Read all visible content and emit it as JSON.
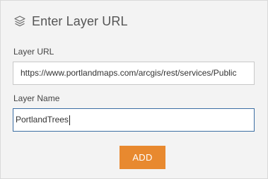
{
  "dialog": {
    "title": "Enter Layer URL",
    "title_icon": "layers-icon"
  },
  "form": {
    "url_label": "Layer URL",
    "url_value": "https://www.portlandmaps.com/arcgis/rest/services/Public",
    "name_label": "Layer Name",
    "name_value": "PortlandTrees",
    "add_button": "ADD"
  },
  "colors": {
    "accent": "#e8892f",
    "focus_border": "#3c6ea3",
    "background": "#f3f3f3"
  }
}
